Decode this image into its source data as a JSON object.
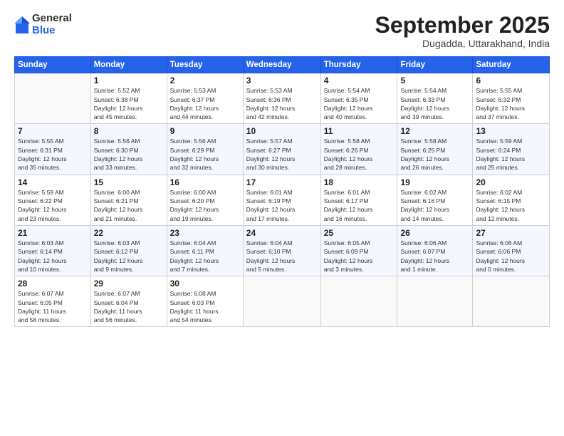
{
  "logo": {
    "general": "General",
    "blue": "Blue"
  },
  "header": {
    "title": "September 2025",
    "subtitle": "Dugadda, Uttarakhand, India"
  },
  "columns": [
    "Sunday",
    "Monday",
    "Tuesday",
    "Wednesday",
    "Thursday",
    "Friday",
    "Saturday"
  ],
  "weeks": [
    [
      {
        "day": "",
        "info": ""
      },
      {
        "day": "1",
        "info": "Sunrise: 5:52 AM\nSunset: 6:38 PM\nDaylight: 12 hours\nand 45 minutes."
      },
      {
        "day": "2",
        "info": "Sunrise: 5:53 AM\nSunset: 6:37 PM\nDaylight: 12 hours\nand 44 minutes."
      },
      {
        "day": "3",
        "info": "Sunrise: 5:53 AM\nSunset: 6:36 PM\nDaylight: 12 hours\nand 42 minutes."
      },
      {
        "day": "4",
        "info": "Sunrise: 5:54 AM\nSunset: 6:35 PM\nDaylight: 12 hours\nand 40 minutes."
      },
      {
        "day": "5",
        "info": "Sunrise: 5:54 AM\nSunset: 6:33 PM\nDaylight: 12 hours\nand 39 minutes."
      },
      {
        "day": "6",
        "info": "Sunrise: 5:55 AM\nSunset: 6:32 PM\nDaylight: 12 hours\nand 37 minutes."
      }
    ],
    [
      {
        "day": "7",
        "info": "Sunrise: 5:55 AM\nSunset: 6:31 PM\nDaylight: 12 hours\nand 35 minutes."
      },
      {
        "day": "8",
        "info": "Sunrise: 5:56 AM\nSunset: 6:30 PM\nDaylight: 12 hours\nand 33 minutes."
      },
      {
        "day": "9",
        "info": "Sunrise: 5:56 AM\nSunset: 6:29 PM\nDaylight: 12 hours\nand 32 minutes."
      },
      {
        "day": "10",
        "info": "Sunrise: 5:57 AM\nSunset: 6:27 PM\nDaylight: 12 hours\nand 30 minutes."
      },
      {
        "day": "11",
        "info": "Sunrise: 5:58 AM\nSunset: 6:26 PM\nDaylight: 12 hours\nand 28 minutes."
      },
      {
        "day": "12",
        "info": "Sunrise: 5:58 AM\nSunset: 6:25 PM\nDaylight: 12 hours\nand 26 minutes."
      },
      {
        "day": "13",
        "info": "Sunrise: 5:59 AM\nSunset: 6:24 PM\nDaylight: 12 hours\nand 25 minutes."
      }
    ],
    [
      {
        "day": "14",
        "info": "Sunrise: 5:59 AM\nSunset: 6:22 PM\nDaylight: 12 hours\nand 23 minutes."
      },
      {
        "day": "15",
        "info": "Sunrise: 6:00 AM\nSunset: 6:21 PM\nDaylight: 12 hours\nand 21 minutes."
      },
      {
        "day": "16",
        "info": "Sunrise: 6:00 AM\nSunset: 6:20 PM\nDaylight: 12 hours\nand 19 minutes."
      },
      {
        "day": "17",
        "info": "Sunrise: 6:01 AM\nSunset: 6:19 PM\nDaylight: 12 hours\nand 17 minutes."
      },
      {
        "day": "18",
        "info": "Sunrise: 6:01 AM\nSunset: 6:17 PM\nDaylight: 12 hours\nand 16 minutes."
      },
      {
        "day": "19",
        "info": "Sunrise: 6:02 AM\nSunset: 6:16 PM\nDaylight: 12 hours\nand 14 minutes."
      },
      {
        "day": "20",
        "info": "Sunrise: 6:02 AM\nSunset: 6:15 PM\nDaylight: 12 hours\nand 12 minutes."
      }
    ],
    [
      {
        "day": "21",
        "info": "Sunrise: 6:03 AM\nSunset: 6:14 PM\nDaylight: 12 hours\nand 10 minutes."
      },
      {
        "day": "22",
        "info": "Sunrise: 6:03 AM\nSunset: 6:12 PM\nDaylight: 12 hours\nand 9 minutes."
      },
      {
        "day": "23",
        "info": "Sunrise: 6:04 AM\nSunset: 6:11 PM\nDaylight: 12 hours\nand 7 minutes."
      },
      {
        "day": "24",
        "info": "Sunrise: 6:04 AM\nSunset: 6:10 PM\nDaylight: 12 hours\nand 5 minutes."
      },
      {
        "day": "25",
        "info": "Sunrise: 6:05 AM\nSunset: 6:09 PM\nDaylight: 12 hours\nand 3 minutes."
      },
      {
        "day": "26",
        "info": "Sunrise: 6:06 AM\nSunset: 6:07 PM\nDaylight: 12 hours\nand 1 minute."
      },
      {
        "day": "27",
        "info": "Sunrise: 6:06 AM\nSunset: 6:06 PM\nDaylight: 12 hours\nand 0 minutes."
      }
    ],
    [
      {
        "day": "28",
        "info": "Sunrise: 6:07 AM\nSunset: 6:05 PM\nDaylight: 11 hours\nand 58 minutes."
      },
      {
        "day": "29",
        "info": "Sunrise: 6:07 AM\nSunset: 6:04 PM\nDaylight: 11 hours\nand 56 minutes."
      },
      {
        "day": "30",
        "info": "Sunrise: 6:08 AM\nSunset: 6:03 PM\nDaylight: 11 hours\nand 54 minutes."
      },
      {
        "day": "",
        "info": ""
      },
      {
        "day": "",
        "info": ""
      },
      {
        "day": "",
        "info": ""
      },
      {
        "day": "",
        "info": ""
      }
    ]
  ]
}
